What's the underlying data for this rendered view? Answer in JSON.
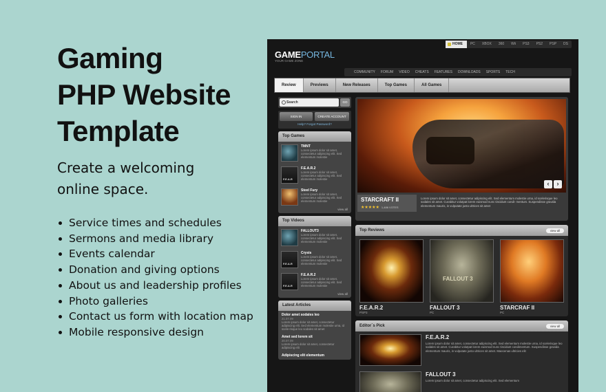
{
  "promo": {
    "title_lines": [
      "Gaming",
      "PHP Website",
      "Template"
    ],
    "subtitle_lines": [
      "Create a welcoming",
      "online space."
    ],
    "features": [
      "Service times and schedules",
      "Sermons and media library",
      "Events calendar",
      "Donation and giving options",
      "About us and leadership profiles",
      "Photo galleries",
      "Contact us form with location map",
      "Mobile responsive design"
    ]
  },
  "site": {
    "platforms": [
      "HOME",
      "PC",
      "XBOX",
      "360",
      "Wii",
      "PS3",
      "PS2",
      "PSP",
      "DS"
    ],
    "logo_main": "GAME",
    "logo_accent": "PORTAL",
    "tagline": "YOUR GAME ZONE",
    "categories": [
      "COMMUNITY",
      "FORUM",
      "VIDEO",
      "CHEATS",
      "FEATURES",
      "DOWNLOADS",
      "SPORTS",
      "TECH"
    ],
    "tabs": [
      "Review",
      "Previews",
      "New Releases",
      "Top Games",
      "All Games"
    ],
    "search": {
      "placeholder": "Search",
      "go": "GO"
    },
    "account": {
      "sign_in": "SIGN IN",
      "create": "CREATE ACCOUNT",
      "links": "Help? Forgot Password?"
    },
    "top_games": {
      "title": "Top Games",
      "items": [
        {
          "name": "TMNT",
          "desc": "Lorem ipsum dolor sit amet, consectetur adipiscing elit. Sed elementum molestie"
        },
        {
          "name": "F.E.A.R.2",
          "desc": "Lorem ipsum dolor sit amet, consectetur adipiscing elit. Sed elementum molestie"
        },
        {
          "name": "Steel Fury",
          "desc": "Lorem ipsum dolor sit amet, consectetur adipiscing elit. Sed elementum molestie"
        }
      ],
      "view_all": "view all"
    },
    "top_videos": {
      "title": "Top Videos",
      "items": [
        {
          "name": "FALLOUT3",
          "desc": "Lorem ipsum dolor sit amet, consectetur adipiscing elit. Sed elementum molestie"
        },
        {
          "name": "Crysis",
          "desc": "Lorem ipsum dolor sit amet, consectetur adipiscing elit. Sed elementum molestie"
        },
        {
          "name": "F.E.A.R.2",
          "desc": "Lorem ipsum dolor sit amet, consectetur adipiscing elit. Sed elementum molestie"
        }
      ],
      "view_all": "view all"
    },
    "latest_articles": {
      "title": "Latest Articles",
      "items": [
        {
          "name": "Dolor amet sodales leo",
          "date": "21.07.09",
          "desc": "Lorem ipsum dolor sit amet, consectetur adipiscing elit. Sed elementum molestie urna, id scele-risque leo sodales sit amet"
        },
        {
          "name": "Amet sed lorem sit",
          "date": "20.07.09",
          "desc": "Lorem ipsum dolor sit amet, consectetur adipiscing elit"
        },
        {
          "name": "Adipiscing elit elementum",
          "date": "",
          "desc": ""
        }
      ]
    },
    "featured": {
      "name": "STARCRAFT II",
      "stars": "★★★★★",
      "votes": "1,486 VOTES",
      "desc": "Lorem ipsum dolor sit amet, consectetur adipiscing elit. Sed elementum molestie urna, id scelerisque leo sodales sit amet. Curabitur volutpat lorem euismod nunc tincidunt condi- mentum. Suspendisse gravida elementum mauris, in vulputate justo ultrices sit amet",
      "prev": "‹",
      "next": "›"
    },
    "top_reviews": {
      "title": "Top Reviews",
      "view_all": "view all",
      "items": [
        {
          "name": "F.E.A.R.2",
          "platform": "PSP3"
        },
        {
          "name": "FALLOUT 3",
          "platform": "PC"
        },
        {
          "name": "STARCRAF II",
          "platform": "PC"
        }
      ]
    },
    "editors_pick": {
      "title": "Editor`s Pick",
      "view_all": "view all",
      "items": [
        {
          "name": "F.E.A.R.2",
          "desc": "Lorem ipsum dolor sit amet, consectetur adipiscing elit. Sed elementum molestie urna, id scelerisque leo sodales sit amet. Curabitur volutpat lorem euismod nunc tincidunt condimentum. Suspendisse gravida elementum mauris, in vulputate justo ultrices sit amet. Maecenas ultricies elit"
        },
        {
          "name": "FALLOUT 3",
          "desc": "Lorem ipsum dolor sit amet, consectetur adipiscing elit. Sed elementum"
        }
      ]
    }
  }
}
